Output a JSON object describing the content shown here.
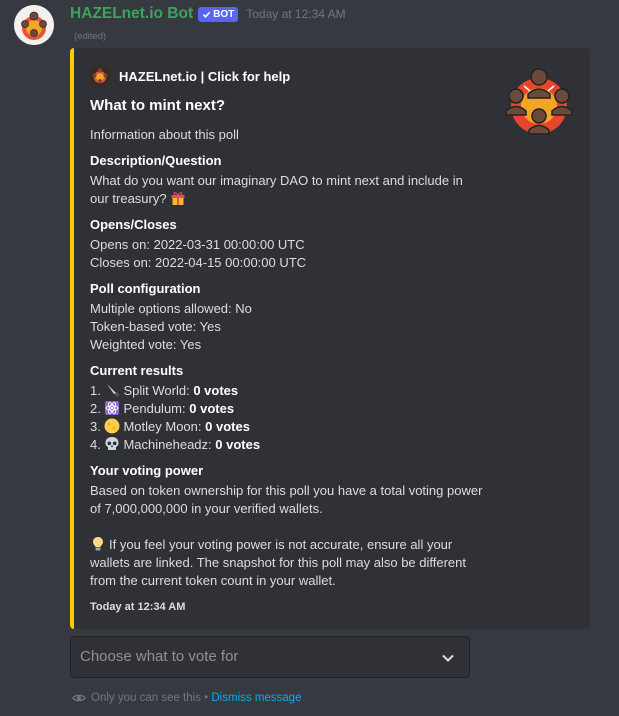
{
  "message": {
    "author": "HAZELnet.io Bot",
    "bot_badge": "BOT",
    "timestamp": "Today at 12:34 AM",
    "edited": "(edited)"
  },
  "embed": {
    "accent_color": "#fdcb00",
    "author_name": "HAZELnet.io | Click for help",
    "title": "What to mint next?",
    "description": "Information about this poll",
    "fields": {
      "description_question": {
        "name": "Description/Question",
        "line1": "What do you want our imaginary DAO to mint next and include in",
        "line2": "our treasury?",
        "emoji": "gift-icon"
      },
      "opens_closes": {
        "name": "Opens/Closes",
        "opens": "Opens on: 2022-03-31 00:00:00 UTC",
        "closes": "Closes on: 2022-04-15 00:00:00 UTC"
      },
      "poll_config": {
        "name": "Poll configuration",
        "multiple": "Multiple options allowed: No",
        "token_based": "Token-based vote: Yes",
        "weighted": "Weighted vote: Yes"
      },
      "current_results": {
        "name": "Current results",
        "items": [
          {
            "num": "1.",
            "label": "Split World:",
            "votes": "0 votes",
            "icon": "knife-icon"
          },
          {
            "num": "2.",
            "label": "Pendulum:",
            "votes": "0 votes",
            "icon": "atom-icon"
          },
          {
            "num": "3.",
            "label": "Motley Moon:",
            "votes": "0 votes",
            "icon": "moon-icon"
          },
          {
            "num": "4.",
            "label": "Machineheadz:",
            "votes": "0 votes",
            "icon": "skull-icon"
          }
        ]
      },
      "voting_power": {
        "name": "Your voting power",
        "line1": "Based on token ownership for this poll you have a total voting power",
        "line2": "of 7,000,000,000 in your verified wallets.",
        "tip1": "If you feel your voting power is not accurate, ensure all your",
        "tip2": "wallets are linked. The snapshot for this poll may also be different",
        "tip3": "from the current token count in your wallet.",
        "tip_icon": "lightbulb-icon"
      }
    },
    "footer_timestamp": "Today at 12:34 AM"
  },
  "select_menu": {
    "placeholder": "Choose what to vote for"
  },
  "ephemeral": {
    "notice": "Only you can see this •",
    "dismiss": "Dismiss message"
  }
}
